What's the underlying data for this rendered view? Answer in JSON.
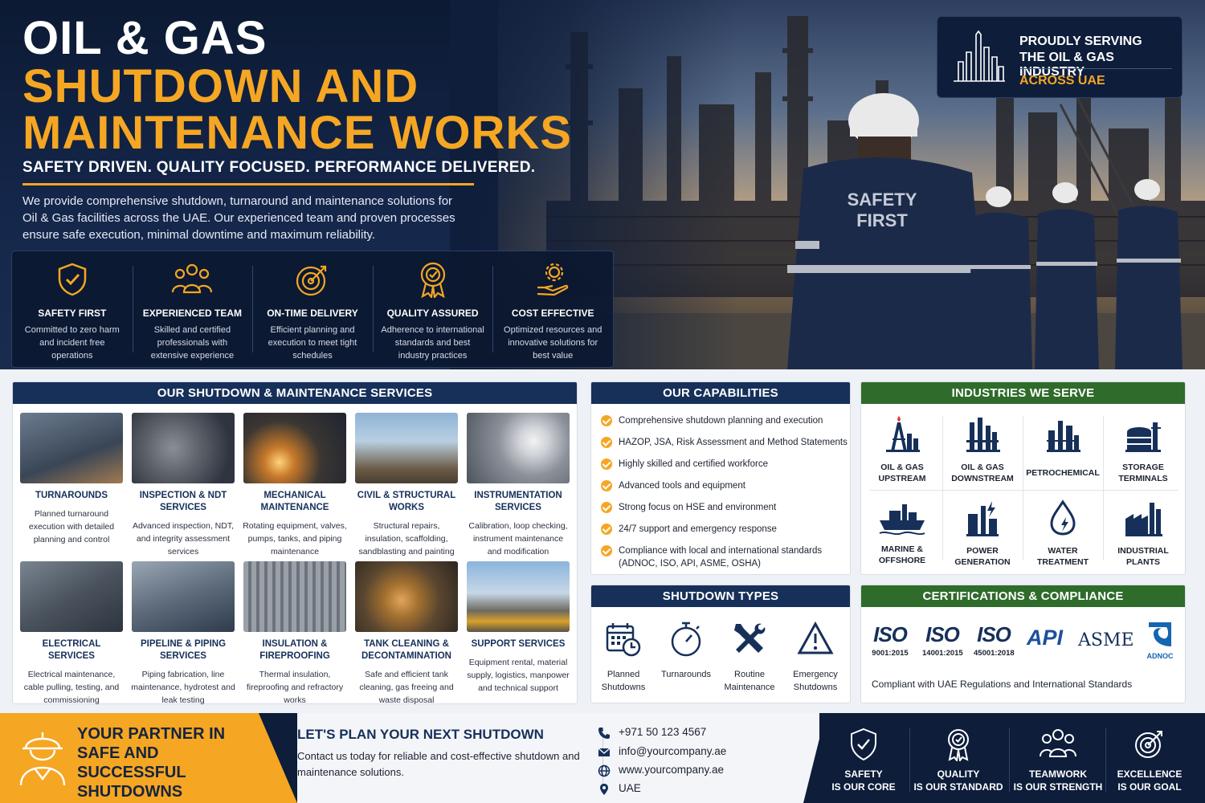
{
  "hero": {
    "title_line1": "OIL & GAS",
    "title_line2": "SHUTDOWN AND",
    "title_line3": "MAINTENANCE WORKS",
    "tagline": "SAFETY DRIVEN. QUALITY FOCUSED. PERFORMANCE DELIVERED.",
    "description": "We provide comprehensive shutdown, turnaround and maintenance solutions for Oil & Gas facilities across the UAE. Our experienced team and proven processes ensure safe execution, minimal downtime and maximum reliability.",
    "vest_text_1": "SAFETY",
    "vest_text_2": "FIRST"
  },
  "serving": {
    "line1": "PROUDLY SERVING",
    "line2": "THE OIL & GAS INDUSTRY",
    "line3": "ACROSS UAE"
  },
  "features": [
    {
      "icon": "shield-check-icon",
      "title": "SAFETY FIRST",
      "desc": "Committed to zero harm and incident free operations"
    },
    {
      "icon": "team-icon",
      "title": "EXPERIENCED TEAM",
      "desc": "Skilled and certified professionals with extensive experience"
    },
    {
      "icon": "target-icon",
      "title": "ON-TIME DELIVERY",
      "desc": "Efficient planning and execution to meet tight schedules"
    },
    {
      "icon": "award-icon",
      "title": "QUALITY ASSURED",
      "desc": "Adherence to international standards and best industry practices"
    },
    {
      "icon": "hand-gear-icon",
      "title": "COST EFFECTIVE",
      "desc": "Optimized resources and innovative solutions for best value"
    }
  ],
  "services": {
    "heading": "OUR SHUTDOWN & MAINTENANCE SERVICES",
    "items": [
      {
        "title": "TURNAROUNDS",
        "desc": "Planned turnaround execution with detailed planning and control"
      },
      {
        "title": "INSPECTION & NDT SERVICES",
        "desc": "Advanced inspection, NDT, and integrity assessment services"
      },
      {
        "title": "MECHANICAL MAINTENANCE",
        "desc": "Rotating equipment, valves, pumps, tanks, and piping maintenance"
      },
      {
        "title": "CIVIL & STRUCTURAL WORKS",
        "desc": "Structural repairs, insulation, scaffolding, sandblasting and painting"
      },
      {
        "title": "INSTRUMENTATION SERVICES",
        "desc": "Calibration, loop checking, instrument maintenance and modification"
      },
      {
        "title": "ELECTRICAL SERVICES",
        "desc": "Electrical maintenance, cable pulling, testing, and commissioning"
      },
      {
        "title": "PIPELINE & PIPING SERVICES",
        "desc": "Piping fabrication, line maintenance, hydrotest and leak testing"
      },
      {
        "title": "INSULATION & FIREPROOFING",
        "desc": "Thermal insulation, fireproofing and refractory works"
      },
      {
        "title": "TANK CLEANING & DECONTAMINATION",
        "desc": "Safe and efficient tank cleaning, gas freeing and waste disposal"
      },
      {
        "title": "SUPPORT SERVICES",
        "desc": "Equipment rental, material supply, logistics, manpower and technical support"
      }
    ]
  },
  "capabilities": {
    "heading": "OUR CAPABILITIES",
    "items": [
      "Comprehensive shutdown planning and execution",
      "HAZOP, JSA, Risk Assessment and Method Statements",
      "Highly skilled and certified workforce",
      "Advanced tools and equipment",
      "Strong focus on HSE and environment",
      "24/7 support and emergency response",
      "Compliance with local and international standards (ADNOC, ISO, API, ASME, OSHA)"
    ]
  },
  "industries": {
    "heading": "INDUSTRIES WE SERVE",
    "items": [
      {
        "icon": "upstream-icon",
        "label": "OIL & GAS UPSTREAM"
      },
      {
        "icon": "downstream-icon",
        "label": "OIL & GAS DOWNSTREAM"
      },
      {
        "icon": "petrochemical-icon",
        "label": "PETROCHEMICAL"
      },
      {
        "icon": "storage-tank-icon",
        "label": "STORAGE TERMINALS"
      },
      {
        "icon": "ship-icon",
        "label": "MARINE & OFFSHORE"
      },
      {
        "icon": "power-plant-icon",
        "label": "POWER GENERATION"
      },
      {
        "icon": "water-drop-icon",
        "label": "WATER TREATMENT"
      },
      {
        "icon": "factory-icon",
        "label": "INDUSTRIAL PLANTS"
      }
    ]
  },
  "shutdown_types": {
    "heading": "SHUTDOWN TYPES",
    "items": [
      {
        "icon": "calendar-clock-icon",
        "label": "Planned Shutdowns"
      },
      {
        "icon": "stopwatch-icon",
        "label": "Turnarounds"
      },
      {
        "icon": "tools-icon",
        "label": "Routine Maintenance"
      },
      {
        "icon": "warning-icon",
        "label": "Emergency Shutdowns"
      }
    ]
  },
  "certifications": {
    "heading": "CERTIFICATIONS & COMPLIANCE",
    "iso": [
      {
        "logo": "ISO",
        "code": "9001:2015"
      },
      {
        "logo": "ISO",
        "code": "14001:2015"
      },
      {
        "logo": "ISO",
        "code": "45001:2018"
      }
    ],
    "api": "API",
    "asme": "ASME",
    "adnoc": "ADNOC",
    "note": "Compliant with UAE Regulations and International Standards"
  },
  "footer": {
    "partner": "YOUR PARTNER IN SAFE AND SUCCESSFUL SHUTDOWNS",
    "cta_heading": "LET'S PLAN YOUR NEXT SHUTDOWN",
    "cta_text": "Contact us today for reliable and cost-effective shutdown and maintenance solutions.",
    "phone": "+971 50 123 4567",
    "email": "info@yourcompany.ae",
    "website": "www.yourcompany.ae",
    "location": "UAE",
    "values": [
      {
        "icon": "shield-check-icon",
        "line1": "SAFETY",
        "line2": "IS OUR CORE"
      },
      {
        "icon": "award-icon",
        "line1": "QUALITY",
        "line2": "IS OUR STANDARD"
      },
      {
        "icon": "team-icon",
        "line1": "TEAMWORK",
        "line2": "IS OUR STRENGTH"
      },
      {
        "icon": "target-icon",
        "line1": "EXCELLENCE",
        "line2": "IS OUR GOAL"
      }
    ]
  },
  "colors": {
    "navy": "#16305a",
    "orange": "#f5a623",
    "green": "#2f6b2a"
  }
}
